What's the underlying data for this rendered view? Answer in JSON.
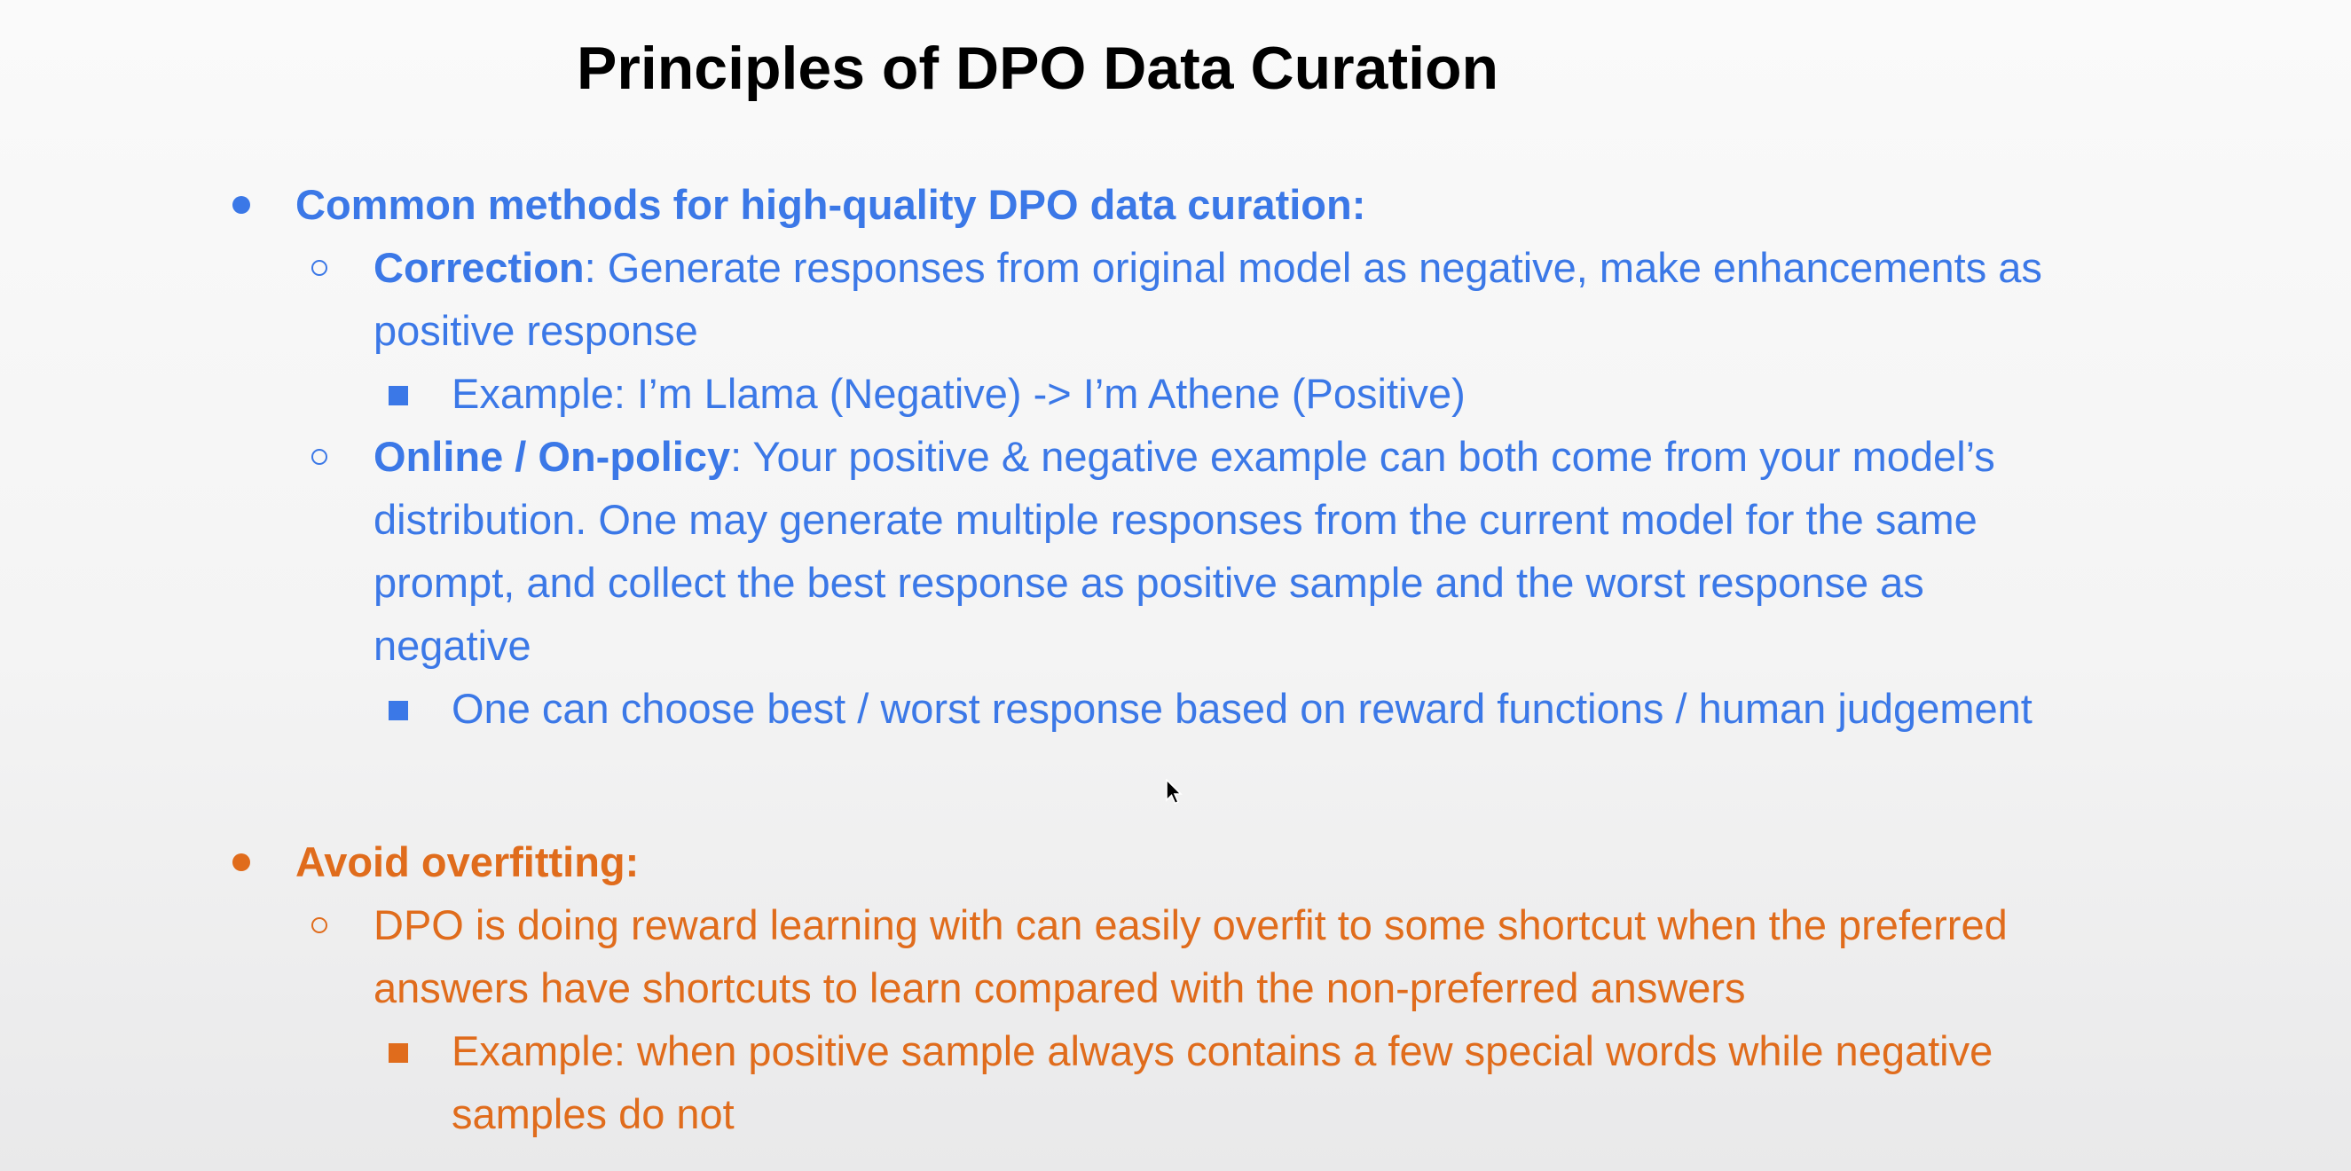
{
  "title": "Principles of DPO Data Curation",
  "colors": {
    "blue": "#3b78e7",
    "orange": "#e06c1c",
    "title": "#000000"
  },
  "section1": {
    "heading": "Common methods for high-quality DPO data curation:",
    "correction": {
      "term": "Correction",
      "text_line1": ": Generate responses from original model as negative, make enhancements as",
      "text_line2": "positive response",
      "example": "Example: I’m Llama (Negative) -> I’m Athene (Positive)"
    },
    "online": {
      "term": "Online / On-policy",
      "text_line1": ": Your positive & negative example can both come from your model’s",
      "text_line2": "distribution. One may generate multiple responses from the current model for the same",
      "text_line3": "prompt, and collect the best response as positive sample and the worst response as",
      "text_line4": "negative",
      "example": "One can choose best / worst response based on reward functions / human judgement"
    }
  },
  "section2": {
    "heading": "Avoid overfitting:",
    "point_line1": "DPO is doing reward learning with can easily overfit to some shortcut when the preferred",
    "point_line2": "answers have shortcuts to learn compared with the non-preferred answers",
    "example_line1": "Example: when positive sample always contains a few special words while negative",
    "example_line2": "samples do not"
  }
}
